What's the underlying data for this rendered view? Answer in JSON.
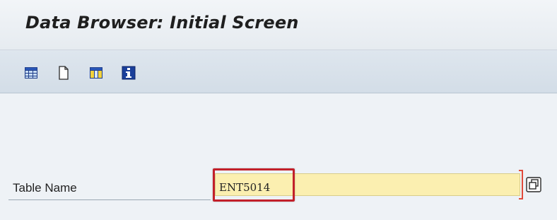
{
  "header": {
    "title": "Data Browser: Initial Screen"
  },
  "toolbar": {
    "buttons": [
      {
        "icon": "table-contents-icon"
      },
      {
        "icon": "new-entries-icon"
      },
      {
        "icon": "table-view-icon"
      },
      {
        "icon": "info-icon"
      }
    ]
  },
  "form": {
    "table_name_label": "Table Name",
    "table_name_value": "ENT5014"
  },
  "colors": {
    "highlight": "#c2202a",
    "input_bg": "#fbefb0",
    "toolbar_bg": "#d9e2eb"
  }
}
